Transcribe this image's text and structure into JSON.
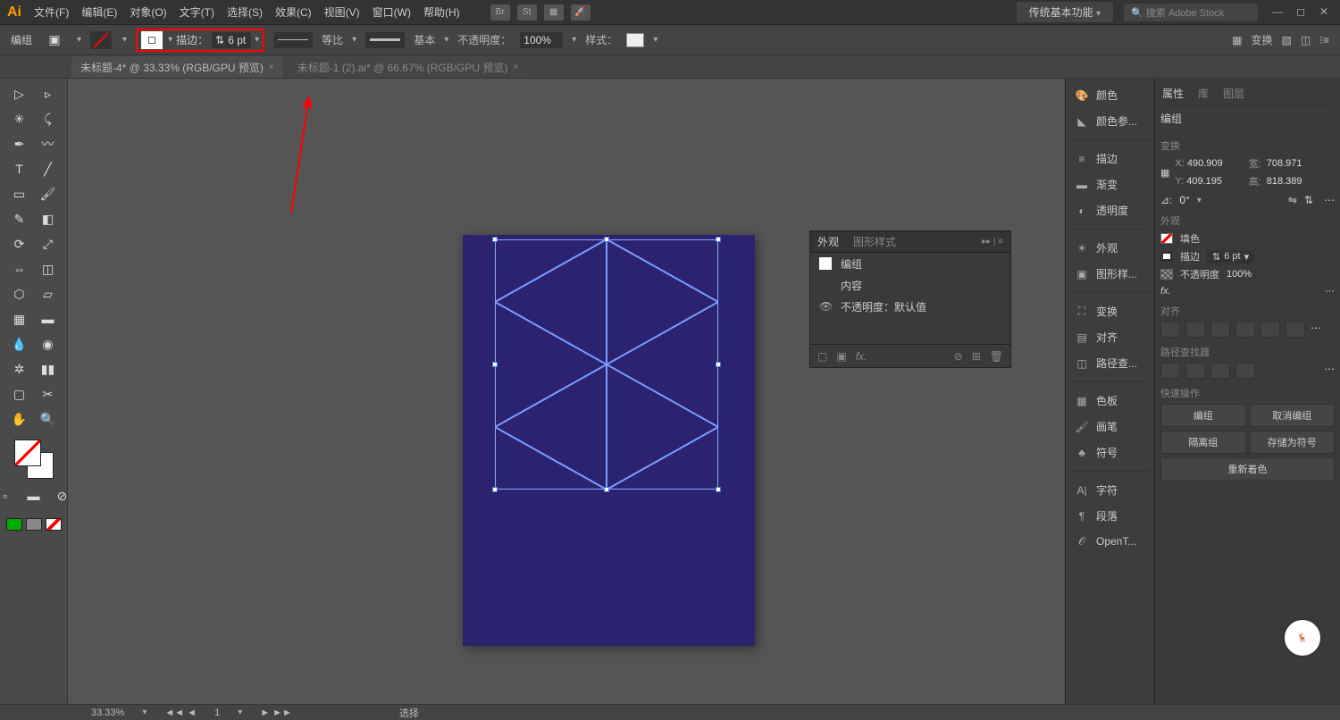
{
  "menubar": {
    "items": [
      "文件(F)",
      "编辑(E)",
      "对象(O)",
      "文字(T)",
      "选择(S)",
      "效果(C)",
      "视图(V)",
      "窗口(W)",
      "帮助(H)"
    ],
    "workspace": "传统基本功能",
    "search_placeholder": "搜索 Adobe Stock"
  },
  "controlbar": {
    "mode": "编组",
    "stroke_label": "描边：",
    "stroke_weight": "6 pt",
    "scale_label": "等比",
    "style_label": "基本",
    "opacity_label": "不透明度：",
    "opacity_value": "100%",
    "style2_label": "样式：",
    "transform_label": "变换"
  },
  "tabs": [
    {
      "label": "未标题-4* @ 33.33% (RGB/GPU 预览)",
      "active": true
    },
    {
      "label": "未标题-1 (2).ai* @ 66.67% (RGB/GPU 预览)",
      "active": false
    }
  ],
  "appearance": {
    "tab1": "外观",
    "tab2": "图形样式",
    "group": "编组",
    "content": "内容",
    "opacity_row": "不透明度：默认值"
  },
  "dock": {
    "items": [
      "颜色",
      "颜色参...",
      "描边",
      "渐变",
      "透明度",
      "外观",
      "图形样...",
      "变换",
      "对齐",
      "路径查...",
      "色板",
      "画笔",
      "符号",
      "字符",
      "段落",
      "OpenT..."
    ]
  },
  "props": {
    "tabs": [
      "属性",
      "库",
      "图层"
    ],
    "group": "编组",
    "transform": "变换",
    "x": "490.909",
    "y": "409.195",
    "w": "708.971",
    "h": "818.389",
    "angle": "0°",
    "x_lbl": "X:",
    "y_lbl": "Y:",
    "w_lbl": "宽:",
    "h_lbl": "高:",
    "appearance": "外观",
    "fill": "填色",
    "stroke": "描边",
    "stroke_w": "6 pt",
    "opacity": "不透明度",
    "opacity_val": "100%",
    "fx": "fx.",
    "align": "对齐",
    "pathfinder": "路径查找器",
    "quick": "快速操作",
    "btn_group": "编组",
    "btn_ungroup": "取消编组",
    "btn_isolate": "隔离组",
    "btn_save_symbol": "存储为符号",
    "btn_recolor": "重新着色"
  },
  "statusbar": {
    "zoom": "33.33%",
    "artboard": "1",
    "tool": "选择"
  }
}
